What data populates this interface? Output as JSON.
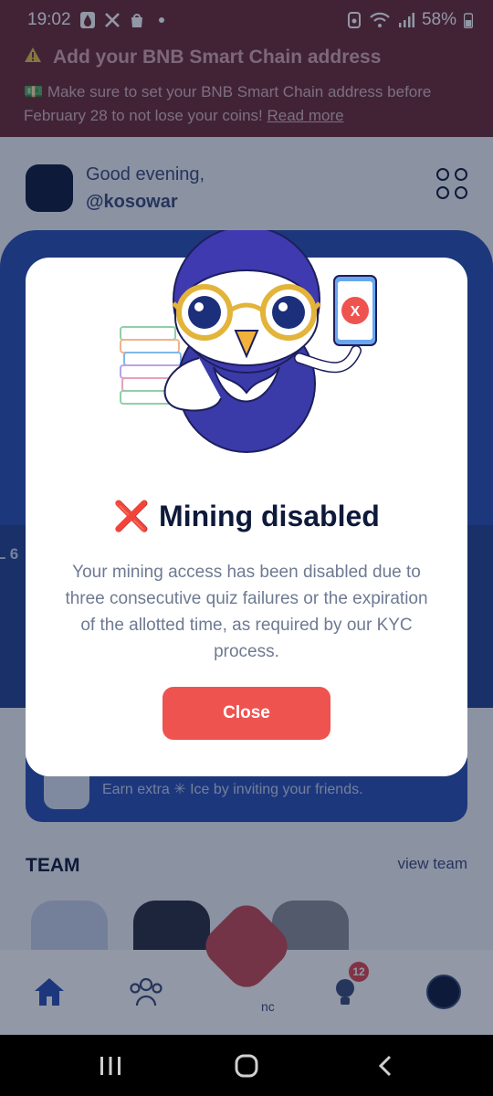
{
  "status_bar": {
    "time": "19:02",
    "battery": "58%",
    "icons": [
      "drop-icon",
      "x-icon",
      "shopping-bag-icon",
      "dot-icon",
      "data-saver-icon",
      "wifi-icon",
      "signal-icon",
      "battery-icon"
    ]
  },
  "banner": {
    "icon": "warning-icon",
    "title": "Add your BNB Smart Chain address",
    "text": "💵 Make sure to set your BNB Smart Chain address before February 28 to not lose your coins!",
    "link": "Read more"
  },
  "header": {
    "greeting": "Good evening,",
    "username": "@kosowar"
  },
  "background": {
    "level_left": "L 6",
    "invite_text": "Earn extra ✳ Ice by inviting your friends.",
    "team_title": "TEAM",
    "view_team": "view team",
    "nav_partial": "nc"
  },
  "bottom_nav": {
    "items": [
      "home-icon",
      "team-icon",
      "ice-logo-icon",
      "news-icon",
      "profile-icon"
    ],
    "news_badge": "12"
  },
  "modal": {
    "title_icon": "❌",
    "title": "Mining disabled",
    "message": "Your mining access has been disabled due to three consecutive quiz failures or the expiration of the allotted time, as required by our KYC process.",
    "close_label": "Close",
    "phone_mark": "X"
  },
  "colors": {
    "banner_bg": "#6d2a34",
    "card_blue": "#2b4fb3",
    "close_red": "#ef5350",
    "title_navy": "#0e1a3a"
  }
}
